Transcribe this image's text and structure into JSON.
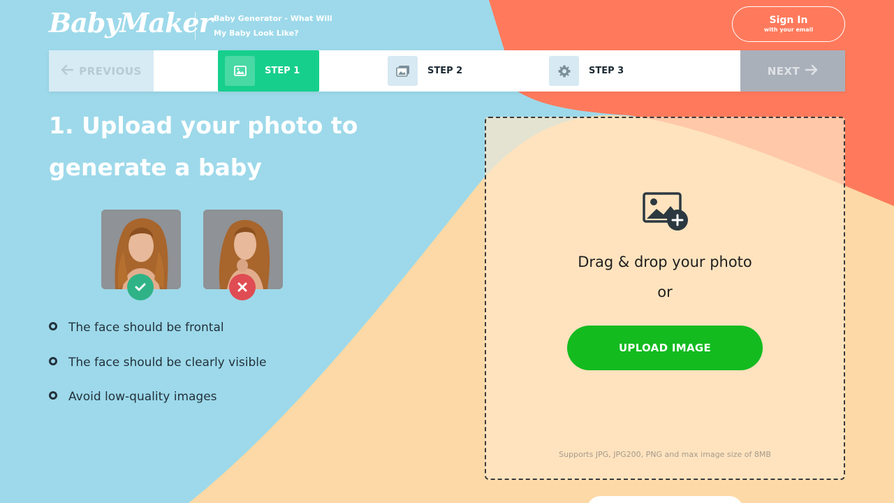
{
  "header": {
    "logo": "BabyMaker",
    "tagline": "Baby Generator - What Will My Baby Look Like?",
    "signin_label": "Sign In",
    "signin_sub": "with your email"
  },
  "steps": {
    "previous_label": "PREVIOUS",
    "next_label": "NEXT",
    "items": [
      {
        "label": "STEP 1",
        "icon": "image-icon",
        "active": true
      },
      {
        "label": "STEP 2",
        "icon": "images-icon",
        "active": false
      },
      {
        "label": "STEP 3",
        "icon": "gear-icon",
        "active": false
      }
    ]
  },
  "main": {
    "heading": "1. Upload your photo to generate a baby",
    "tips": [
      "The face should be frontal",
      "The face should be clearly visible",
      "Avoid low-quality images"
    ]
  },
  "upload": {
    "drag_text": "Drag & drop your photo",
    "or_text": "or",
    "button_label": "UPLOAD IMAGE",
    "note": "Supports JPG, JPG200, PNG and max image size of 8MB"
  },
  "colors": {
    "background_blue": "#9dd9ea",
    "coral": "#ff7a5c",
    "peach": "#fcd9a6",
    "step_active": "#17cf8c",
    "upload_button": "#13bb1f",
    "good_badge": "#2fb386",
    "bad_badge": "#e04c53"
  }
}
